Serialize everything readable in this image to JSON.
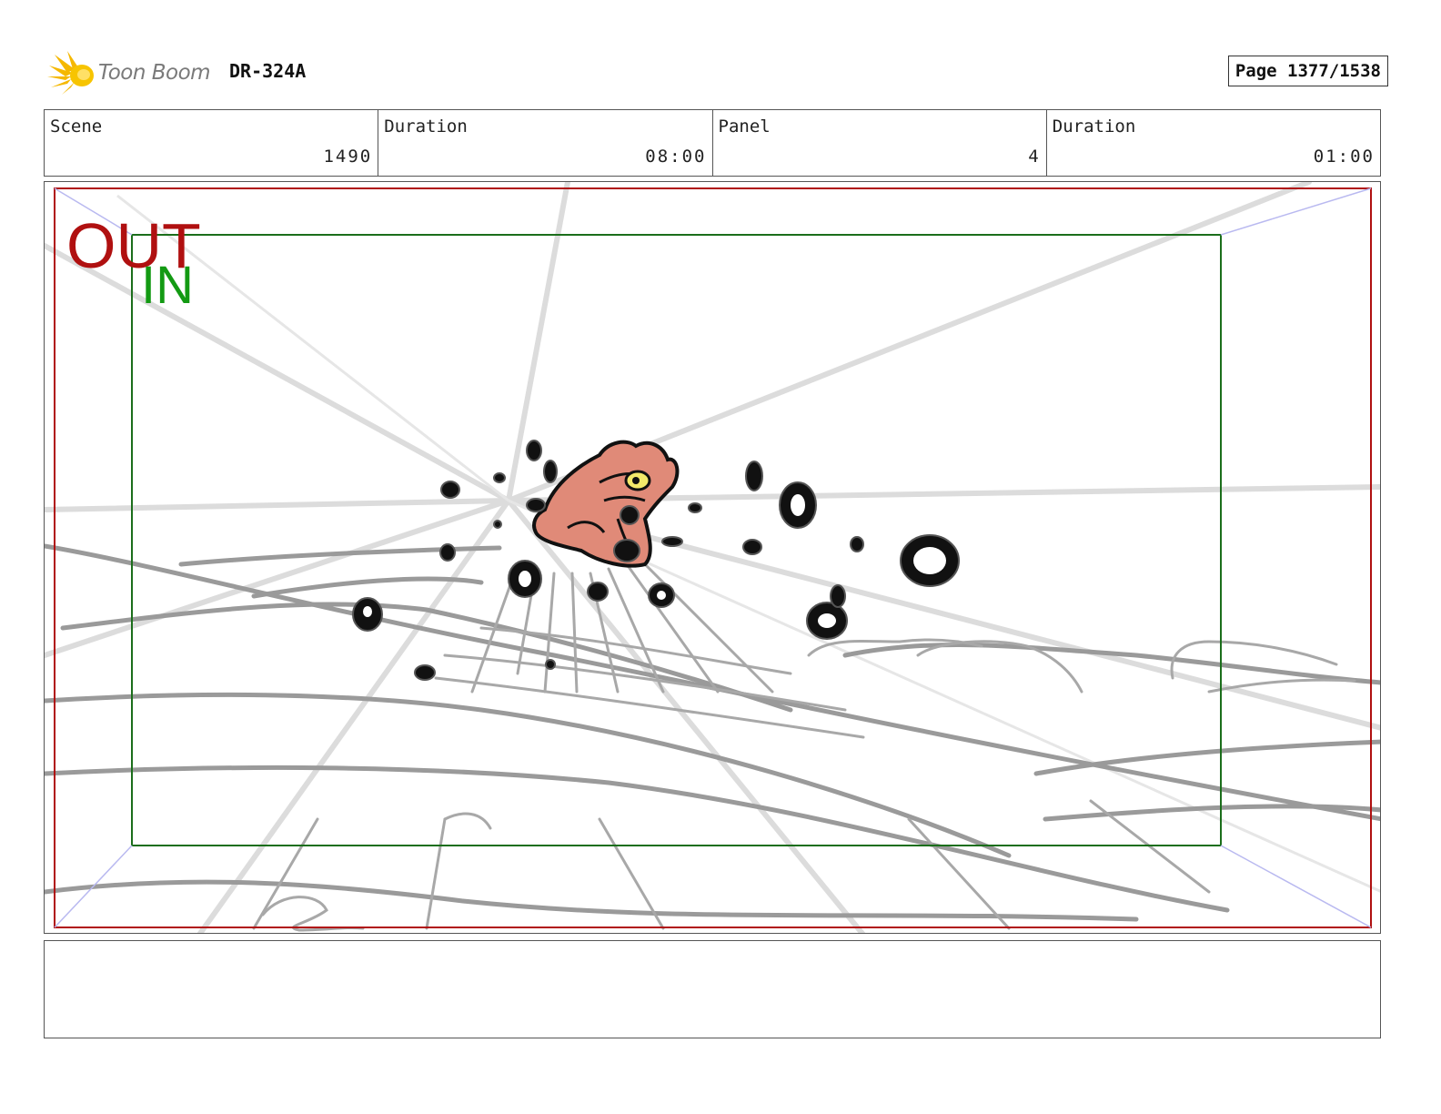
{
  "header": {
    "logo_text": "Toon Boom",
    "project_code": "DR-324A",
    "page_label": "Page 1377/1538"
  },
  "info": [
    {
      "label": "Scene",
      "value": "1490"
    },
    {
      "label": "Duration",
      "value": "08:00"
    },
    {
      "label": "Panel",
      "value": "4"
    },
    {
      "label": "Duration",
      "value": "01:00"
    }
  ],
  "frame": {
    "out_label": "OUT",
    "in_label": "IN",
    "out_color": "#b01010",
    "in_color": "#139a13"
  },
  "notes": {
    "text": ""
  }
}
